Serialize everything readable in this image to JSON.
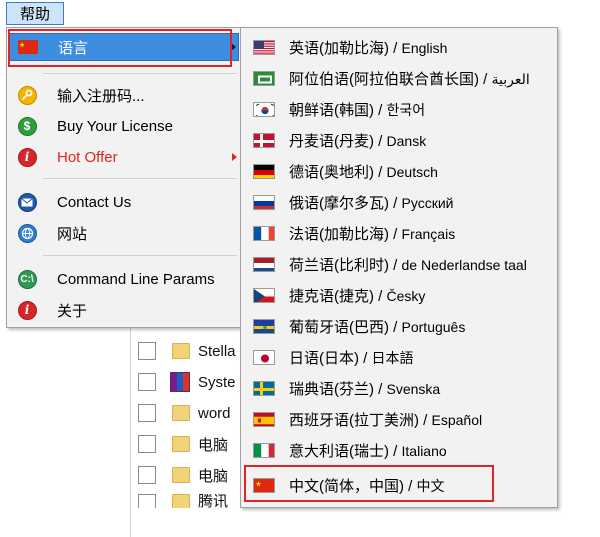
{
  "menubar": {
    "help_label": "帮助"
  },
  "background_list": {
    "items": [
      {
        "label": "Stella",
        "icon": "folder-icon"
      },
      {
        "label": "Syste",
        "icon": "winrar-icon"
      },
      {
        "label": "word",
        "icon": "folder-icon"
      },
      {
        "label": "电脑",
        "icon": "folder-icon"
      },
      {
        "label": "电脑",
        "icon": "folder-icon"
      },
      {
        "label": "腾讯",
        "icon": "folder-icon"
      }
    ]
  },
  "main_menu": {
    "items": [
      {
        "label": "语言",
        "icon": "china-flag-icon",
        "has_submenu": true,
        "active": true
      },
      {
        "label": "输入注册码...",
        "icon": "key-icon"
      },
      {
        "label": "Buy Your License",
        "icon": "dollar-icon"
      },
      {
        "label": "Hot Offer",
        "icon": "info-icon",
        "has_submenu": true,
        "color": "#e52421"
      },
      {
        "label": "Contact Us",
        "icon": "envelope-icon"
      },
      {
        "label": "网站",
        "icon": "globe-icon"
      },
      {
        "label": "Command Line Params",
        "icon": "command-line-icon"
      },
      {
        "label": "关于",
        "icon": "info-icon"
      }
    ]
  },
  "language_menu": {
    "items": [
      {
        "zh": "英语(加勒比海)",
        "native": "English",
        "icon": "us-flag-icon"
      },
      {
        "zh": "阿位伯语(阿拉伯联合酋长国)",
        "native": "العربية",
        "icon": "uae-flag-icon"
      },
      {
        "zh": "朝鲜语(韩国)",
        "native": "한국어",
        "icon": "korea-flag-icon"
      },
      {
        "zh": "丹麦语(丹麦)",
        "native": "Dansk",
        "icon": "denmark-flag-icon"
      },
      {
        "zh": "德语(奥地利)",
        "native": "Deutsch",
        "icon": "germany-flag-icon"
      },
      {
        "zh": "俄语(摩尔多瓦)",
        "native": "Русский",
        "icon": "russia-flag-icon"
      },
      {
        "zh": "法语(加勒比海)",
        "native": "Français",
        "icon": "france-flag-icon"
      },
      {
        "zh": "荷兰语(比利时)",
        "native": "de Nederlandse taal",
        "icon": "netherlands-flag-icon"
      },
      {
        "zh": "捷克语(捷克)",
        "native": "Česky",
        "icon": "czech-flag-icon"
      },
      {
        "zh": "葡萄牙语(巴西)",
        "native": "Português",
        "icon": "brazil-flag-icon"
      },
      {
        "zh": "日语(日本)",
        "native": "日本語",
        "icon": "japan-flag-icon"
      },
      {
        "zh": "瑞典语(芬兰)",
        "native": "Svenska",
        "icon": "sweden-flag-icon"
      },
      {
        "zh": "西班牙语(拉丁美洲)",
        "native": "Español",
        "icon": "spain-flag-icon"
      },
      {
        "zh": "意大利语(瑞士)",
        "native": "Italiano",
        "icon": "italy-flag-icon"
      },
      {
        "zh": "中文(简体，中国)",
        "native": "中文",
        "icon": "china-flag-icon",
        "highlighted": true
      }
    ]
  },
  "colors": {
    "highlight_blue": "#3d8ee0",
    "annotation_red": "#e0242c",
    "hot_offer_red": "#e52421"
  }
}
